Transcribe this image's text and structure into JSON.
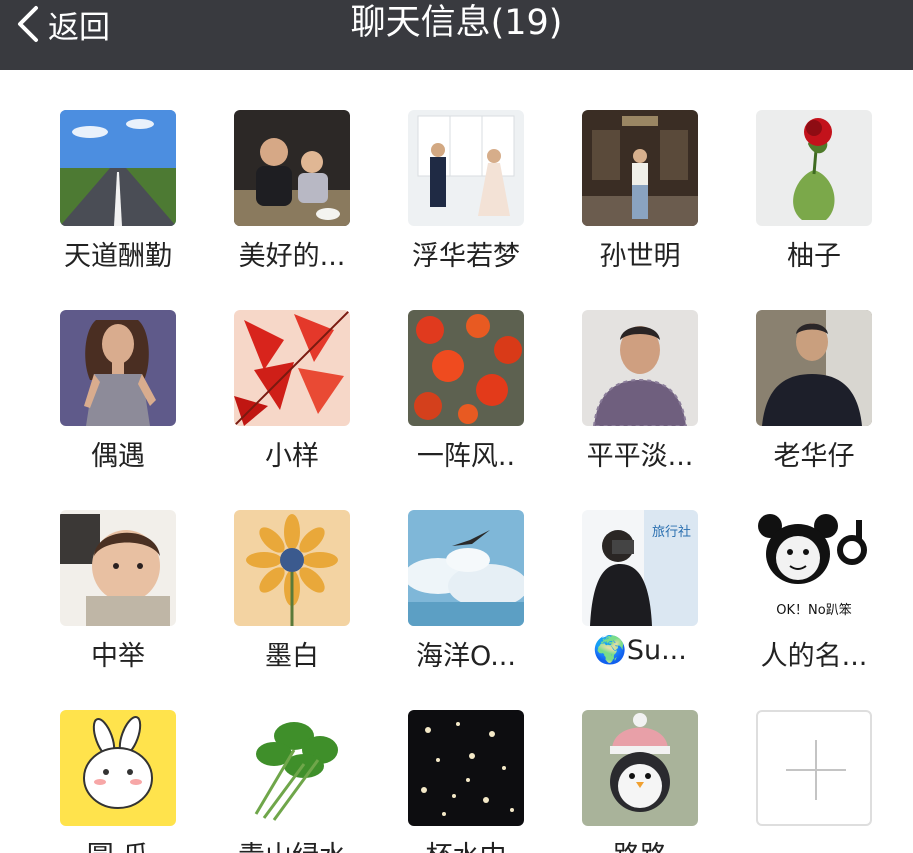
{
  "header": {
    "back_label": "返回",
    "title": "聊天信息(19)"
  },
  "members": [
    {
      "name": "天道酬勤"
    },
    {
      "name": "美好的..."
    },
    {
      "name": "浮华若梦"
    },
    {
      "name": "孙世明"
    },
    {
      "name": "柚子"
    },
    {
      "name": "偶遇"
    },
    {
      "name": "小样"
    },
    {
      "name": "一阵风.."
    },
    {
      "name": "平平淡..."
    },
    {
      "name": "老华仔"
    },
    {
      "name": "中举"
    },
    {
      "name": "墨白"
    },
    {
      "name": "海洋O..."
    },
    {
      "name": "Su...",
      "prefix_icon": "globe-icon"
    },
    {
      "name": "人的名..."
    },
    {
      "name": "圆 瓜"
    },
    {
      "name": "青山绿水"
    },
    {
      "name": "杯水中"
    },
    {
      "name": "路路"
    }
  ],
  "avatar_texts": {
    "panda_caption": "OK！No趴笨",
    "banner_text": "旅行社"
  },
  "add_member_icon": "plus-icon",
  "colors": {
    "navbar": "#393a3f",
    "background": "#ffffff",
    "text": "#222222"
  }
}
